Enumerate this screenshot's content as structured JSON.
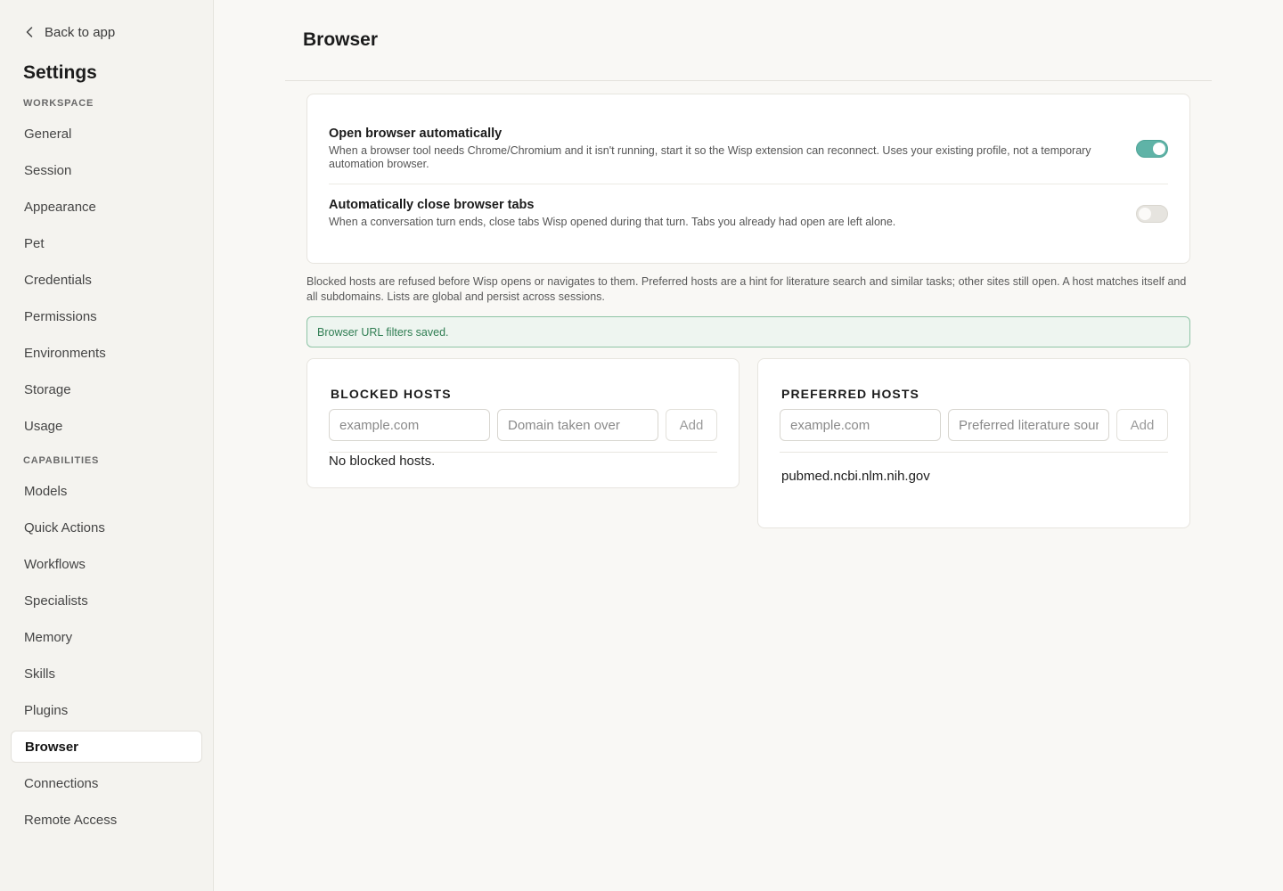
{
  "sidebar": {
    "back_label": "Back to app",
    "back_icon": "chevron-left-icon",
    "title": "Settings",
    "sections": [
      {
        "label": "WORKSPACE",
        "items": [
          "General",
          "Session",
          "Appearance",
          "Pet",
          "Credentials",
          "Permissions",
          "Environments",
          "Storage",
          "Usage"
        ]
      },
      {
        "label": "CAPABILITIES",
        "items": [
          "Models",
          "Quick Actions",
          "Workflows",
          "Specialists",
          "Memory",
          "Skills",
          "Plugins",
          "Browser",
          "Connections",
          "Remote Access"
        ]
      }
    ],
    "active_item": "Browser"
  },
  "page": {
    "title": "Browser"
  },
  "toggles": [
    {
      "title": "Open browser automatically",
      "description": "When a browser tool needs Chrome/Chromium and it isn't running, start it so the Wisp extension can reconnect. Uses your existing profile, not a temporary automation browser.",
      "enabled": true
    },
    {
      "title": "Automatically close browser tabs",
      "description": "When a conversation turn ends, close tabs Wisp opened during that turn. Tabs you already had open are left alone.",
      "enabled": false
    }
  ],
  "help_text": "Blocked hosts are refused before Wisp opens or navigates to them. Preferred hosts are a hint for literature search and similar tasks; other sites still open. A host matches itself and all subdomains. Lists are global and persist across sessions.",
  "status_message": "Browser URL filters saved.",
  "colors": {
    "accent": "#5fb3a7",
    "success_text": "#2f7d52",
    "success_border": "#8fc4a6",
    "success_bg": "#eef5f0"
  },
  "blocked_hosts": {
    "title": "BLOCKED HOSTS",
    "host_placeholder": "example.com",
    "reason_placeholder": "Domain taken over",
    "add_label": "Add",
    "empty_message": "No blocked hosts.",
    "entries": []
  },
  "preferred_hosts": {
    "title": "PREFERRED HOSTS",
    "host_placeholder": "example.com",
    "reason_placeholder": "Preferred literature sour",
    "add_label": "Add",
    "entries": [
      "pubmed.ncbi.nlm.nih.gov"
    ]
  }
}
